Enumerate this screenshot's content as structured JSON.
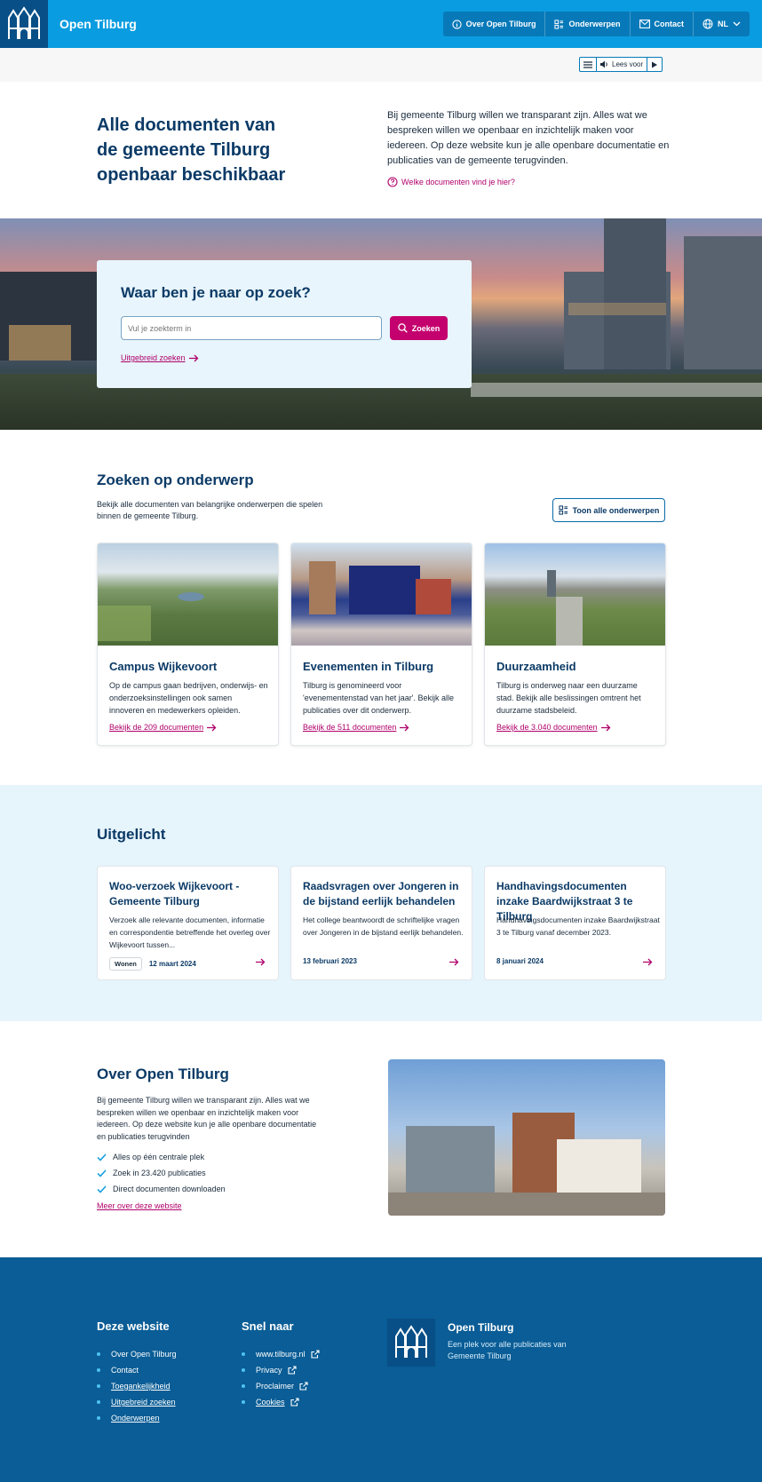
{
  "header": {
    "site_name": "Open Tilburg",
    "nav": [
      {
        "label": "Over Open Tilburg",
        "icon": "info-icon"
      },
      {
        "label": "Onderwerpen",
        "icon": "topics-icon"
      },
      {
        "label": "Contact",
        "icon": "mail-icon"
      },
      {
        "label": "NL",
        "icon": "globe-icon"
      }
    ],
    "readspeaker_label": "Lees voor"
  },
  "intro": {
    "title": "Alle documenten van de gemeente Tilburg openbaar beschikbaar",
    "text": "Bij gemeente Tilburg willen we transparant zijn. Alles wat we bespreken willen we openbaar en inzichtelijk maken voor iedereen. Op deze website kun je alle openbare documentatie en publicaties van de gemeente terugvinden.",
    "link": "Welke documenten vind je hier?"
  },
  "search": {
    "title": "Waar ben je naar op zoek?",
    "placeholder": "Vul je zoekterm in",
    "button": "Zoeken",
    "advanced": "Uitgebreid zoeken"
  },
  "topics": {
    "title": "Zoeken op onderwerp",
    "intro": "Bekijk alle documenten van belangrijke onderwerpen die spelen binnen de gemeente Tilburg.",
    "all_button": "Toon alle onderwerpen",
    "cards": [
      {
        "title": "Campus Wijkevoort",
        "text": "Op de campus gaan bedrijven, onderwijs- en onderzoeksinstellingen ook samen innoveren en medewerkers opleiden.",
        "link": "Bekijk de 209 documenten"
      },
      {
        "title": "Evenementen in Tilburg",
        "text": "Tilburg is genomineerd voor 'evenementenstad van het jaar'. Bekijk alle publicaties over dit onderwerp.",
        "link": "Bekijk de 511 documenten"
      },
      {
        "title": "Duurzaamheid",
        "text": "Tilburg is onderweg naar een duurzame stad. Bekijk alle beslissingen omtrent het duurzame stadsbeleid.",
        "link": "Bekijk de 3.040 documenten"
      }
    ]
  },
  "highlight": {
    "title": "Uitgelicht",
    "cards": [
      {
        "title": "Woo-verzoek Wijkevoort - Gemeente Tilburg",
        "text": "Verzoek alle relevante documenten, informatie en correspondentie betreffende het overleg over Wijkevoort tussen...",
        "badge": "Wonen",
        "date": "12 maart 2024"
      },
      {
        "title": "Raadsvragen over Jongeren in de bijstand eerlijk behandelen",
        "text": "Het college beantwoordt de schriftelijke vragen over Jongeren in de bijstand eerlijk behandelen.",
        "badge": "",
        "date": "13 februari 2023"
      },
      {
        "title": "Handhavingsdocumenten inzake Baardwijkstraat 3 te Tilburg",
        "text": "Handhavingsdocumenten inzake Baardwijkstraat 3 te Tilburg vanaf december 2023.",
        "badge": "",
        "date": "8 januari 2024"
      }
    ]
  },
  "about": {
    "title": "Over Open Tilburg",
    "text": "Bij gemeente Tilburg willen we transparant zijn. Alles wat we bespreken willen we openbaar en inzichtelijk maken voor iedereen. Op deze website kun je alle openbare documentatie en publicaties terugvinden",
    "checks": [
      "Alles op één centrale plek",
      "Zoek in 23.420 publicaties",
      "Direct documenten downloaden"
    ],
    "link": "Meer over deze website"
  },
  "footer": {
    "col1_title": "Deze website",
    "col1_items": [
      "Over Open Tilburg",
      "Contact",
      "Toegankelijkheid",
      "Uitgebreid zoeken",
      "Onderwerpen"
    ],
    "col2_title": "Snel naar",
    "col2_items": [
      "www.tilburg.nl",
      "Privacy",
      "Proclaimer",
      "Cookies"
    ],
    "brand_name": "Open Tilburg",
    "brand_tagline": "Een plek voor alle publicaties van Gemeente Tilburg"
  },
  "colors": {
    "header_blue": "#0a9ce0",
    "dark_blue": "#0b3a66",
    "accent_magenta": "#c4006e",
    "footer_blue": "#0a5d96"
  }
}
